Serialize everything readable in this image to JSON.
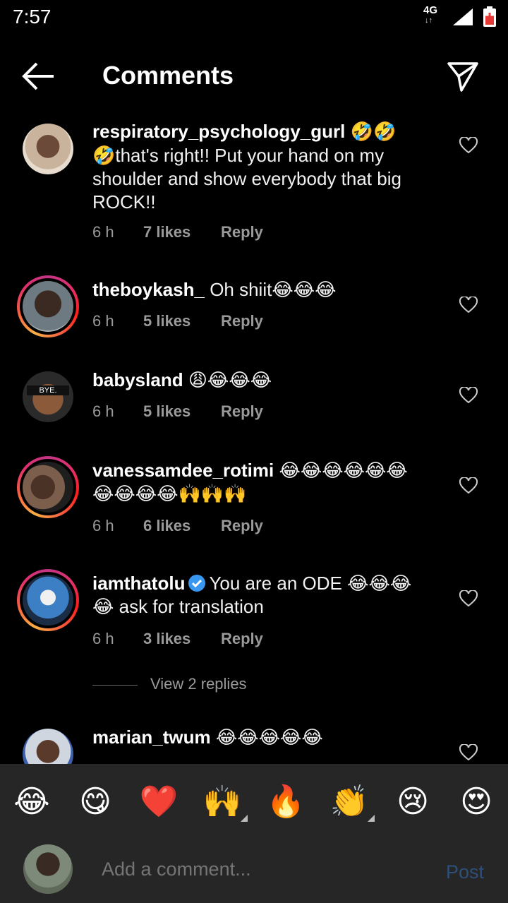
{
  "status_bar": {
    "time": "7:57",
    "network": "4G"
  },
  "header": {
    "title": "Comments"
  },
  "comments": [
    {
      "username": "respiratory_psychology_gurl",
      "emoji_after_name": "🤣🤣",
      "line1_rest": "🤣that's right!! Put your hand on my",
      "line2": "shoulder and show  everybody that big",
      "line3": "ROCK!!",
      "time": "6 h",
      "likes": "7 likes",
      "reply": "Reply"
    },
    {
      "username": "theboykash_",
      "text": "Oh shiit😂😂😂",
      "time": "6 h",
      "likes": "5 likes",
      "reply": "Reply"
    },
    {
      "username": "babysland",
      "text": "😩😂😂😂",
      "avatar_text": "BYE.",
      "time": "6 h",
      "likes": "5 likes",
      "reply": "Reply"
    },
    {
      "username": "vanessamdee_rotimi",
      "text": "😂😂😂😂😂😂",
      "line2": "😂😂😂😂🙌🙌🙌",
      "time": "6 h",
      "likes": "6 likes",
      "reply": "Reply"
    },
    {
      "username": "iamthatolu",
      "text": "You are an ODE 😂😂😂",
      "line2": "😂 ask for translation",
      "time": "6 h",
      "likes": "3 likes",
      "reply": "Reply",
      "view_replies": "View 2 replies"
    },
    {
      "username": "marian_twum",
      "text": "😂😂😂😂😂"
    }
  ],
  "emoji_bar": [
    "😂",
    "😋",
    "❤️",
    "🙌",
    "🔥",
    "👏",
    "😢",
    "😍"
  ],
  "comment_bar": {
    "placeholder": "Add a comment...",
    "post_label": "Post"
  },
  "colors": {
    "background": "#000000",
    "panel": "#262626",
    "meta": "#9a9a9a",
    "post_disabled": "#2e4f79"
  }
}
